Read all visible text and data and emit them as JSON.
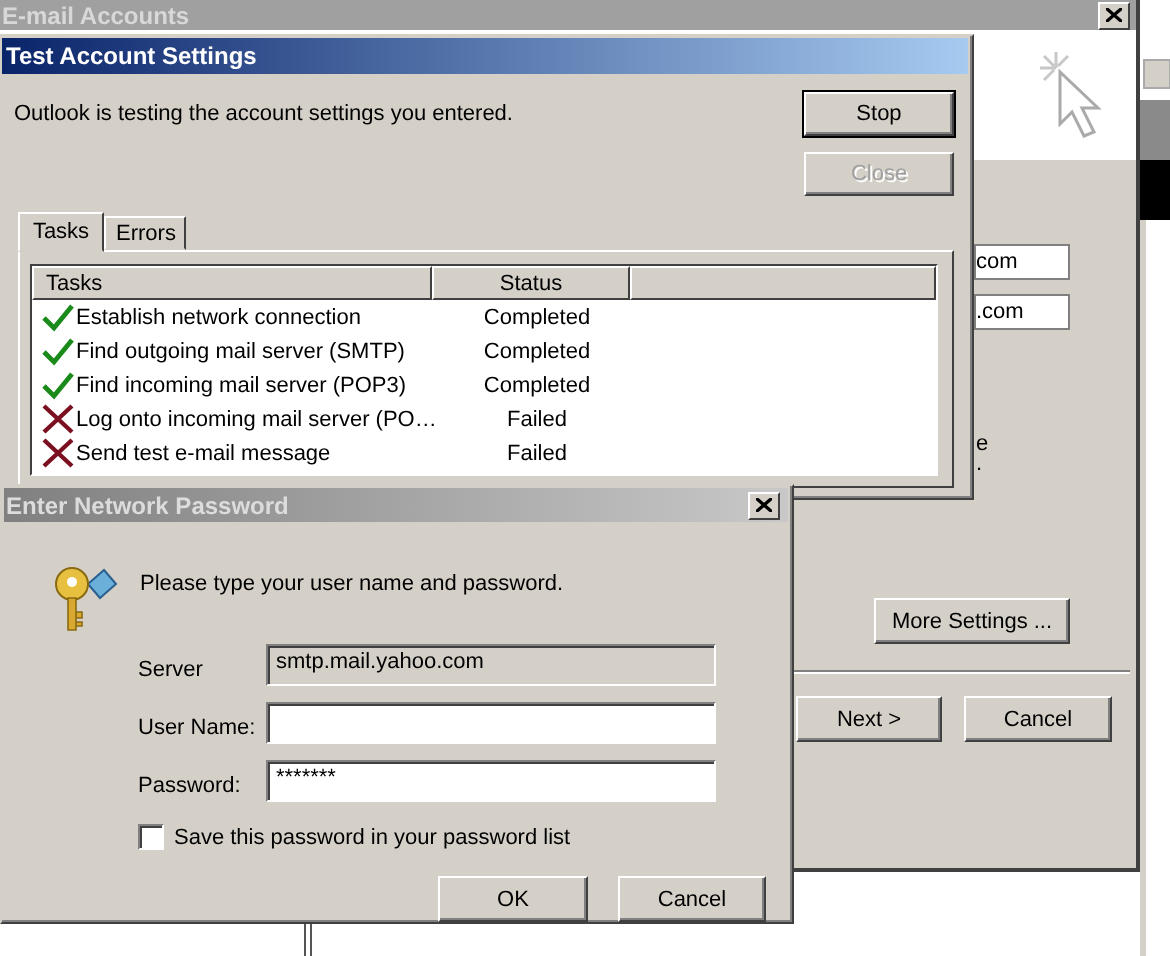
{
  "accounts_window": {
    "title": "E-mail Accounts",
    "field_1": {
      "value": "com"
    },
    "field_2": {
      "value": ".com"
    },
    "partial_texts": [
      "e",
      "."
    ],
    "more_button": "More Settings ...",
    "buttons": [
      {
        "label": "Next >"
      },
      {
        "label": "Cancel"
      }
    ]
  },
  "test_dialog": {
    "title": "Test Account Settings",
    "message": "Outlook is testing the account settings you entered.",
    "buttons": [
      {
        "label": "Stop",
        "disabled": false
      },
      {
        "label": "Close",
        "disabled": true
      }
    ],
    "tabs": [
      {
        "label": "Tasks",
        "selected": true
      },
      {
        "label": "Errors",
        "selected": false
      }
    ],
    "columns": [
      "Tasks",
      "Status"
    ],
    "rows": [
      {
        "task": "Establish network connection",
        "status": "Completed",
        "kind": "completed"
      },
      {
        "task": "Find outgoing mail server (SMTP)",
        "status": "Completed",
        "kind": "completed"
      },
      {
        "task": "Find incoming mail server (POP3)",
        "status": "Completed",
        "kind": "completed"
      },
      {
        "task": "Log onto incoming mail server (PO…",
        "status": "Failed",
        "kind": "failed"
      },
      {
        "task": "Send test e-mail message",
        "status": "Failed",
        "kind": "failed"
      }
    ]
  },
  "password_dialog": {
    "title": "Enter Network Password",
    "prompt": "Please type your user name and password.",
    "fields": [
      {
        "label": "Server",
        "value": "smtp.mail.yahoo.com",
        "disabled": true
      },
      {
        "label": "User Name:",
        "disabled": false
      },
      {
        "label": "Password:",
        "value": "*******",
        "disabled": false
      }
    ],
    "save_password": {
      "label": "Save this password in your password list",
      "checked": false
    },
    "buttons": [
      {
        "label": "OK"
      },
      {
        "label": "Cancel"
      }
    ]
  }
}
